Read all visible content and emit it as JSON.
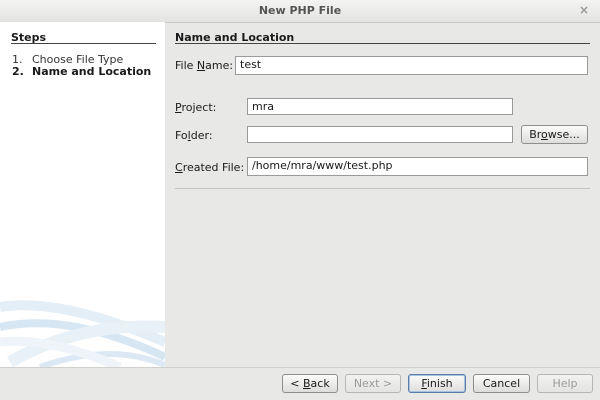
{
  "window": {
    "title": "New PHP File",
    "close_glyph": "×"
  },
  "steps": {
    "title": "Steps",
    "items": [
      {
        "num": "1.",
        "label": "Choose File Type"
      },
      {
        "num": "2.",
        "label": "Name and Location"
      }
    ]
  },
  "panel": {
    "title": "Name and Location",
    "file_name": {
      "label_pre": "File ",
      "label_mn": "N",
      "label_post": "ame:",
      "value": "test"
    },
    "project": {
      "label_pre": "",
      "label_mn": "P",
      "label_post": "roject:",
      "value": "mra"
    },
    "folder": {
      "label_pre": "Fo",
      "label_mn": "l",
      "label_post": "der:",
      "value": ""
    },
    "browse": {
      "pre": "Br",
      "mn": "o",
      "post": "wse..."
    },
    "created_file": {
      "label_pre": "",
      "label_mn": "C",
      "label_post": "reated File:",
      "value": "/home/mra/www/test.php"
    }
  },
  "buttons": {
    "back": {
      "pre": "< ",
      "mn": "B",
      "post": "ack"
    },
    "next": {
      "label": "Next >"
    },
    "finish": {
      "pre": "",
      "mn": "F",
      "post": "inish"
    },
    "cancel": {
      "label": "Cancel"
    },
    "help": {
      "label": "Help"
    }
  },
  "icons": {
    "close": "close-icon"
  }
}
